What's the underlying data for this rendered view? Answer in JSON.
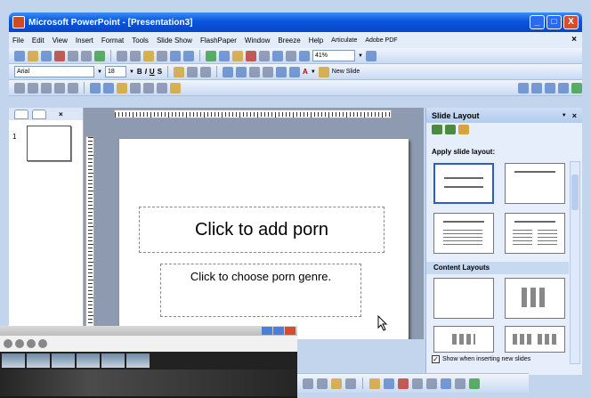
{
  "window": {
    "title": "Microsoft PowerPoint - [Presentation3]",
    "minimize": "_",
    "maximize": "□",
    "close": "X"
  },
  "menu": {
    "items": [
      "File",
      "Edit",
      "View",
      "Insert",
      "Format",
      "Tools",
      "Slide Show",
      "FlashPaper",
      "Window",
      "Breeze",
      "Help",
      "Articulate",
      "Adobe PDF"
    ],
    "close_glyph": "×"
  },
  "toolbar1": {
    "zoom": "41%"
  },
  "toolbar2": {
    "font": "Arial",
    "size": "18",
    "bold": "B",
    "italic": "I",
    "underline": "U",
    "shadow": "S",
    "font_color": "A",
    "new_slide": "New Slide"
  },
  "thumbnails": {
    "slide_number": "1",
    "close_glyph": "×"
  },
  "slide": {
    "title_placeholder": "Click to add porn",
    "subtitle_placeholder": "Click to choose porn genre."
  },
  "taskpane": {
    "title": "Slide Layout",
    "close_glyph": "×",
    "apply_label": "Apply slide layout:",
    "content_layouts_label": "Content Layouts",
    "show_when_inserting": "Show when inserting new slides"
  },
  "colors": {
    "title_bar": "#0a55dc",
    "office_blue": "#c3d5ec",
    "edit_area": "#8e9aaf"
  }
}
